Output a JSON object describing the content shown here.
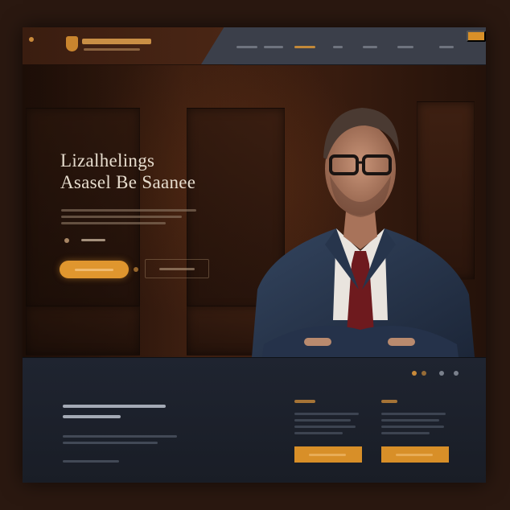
{
  "colors": {
    "accent": "#d89028",
    "wood_dark": "#2c150b",
    "wood_mid": "#4a2514",
    "footer_bg": "#1f2430",
    "headline_text": "#e6dccd",
    "suit": "#2a3850",
    "tie": "#6e1a1e"
  },
  "brand": {
    "logo_icon": "shield-icon",
    "name": "",
    "tagline": ""
  },
  "nav": {
    "items": [
      {
        "label": "",
        "active": false
      },
      {
        "label": "",
        "active": false
      },
      {
        "label": "",
        "active": true
      },
      {
        "label": "",
        "active": false
      },
      {
        "label": "",
        "active": false
      },
      {
        "label": "",
        "active": false
      }
    ],
    "cta_label": ""
  },
  "hero": {
    "headline_line1": "Lizalhelings",
    "headline_line2": "Asasel Be Saanee",
    "paragraph": "",
    "meta_icon": "info-icon",
    "meta_text": "",
    "primary_button": "",
    "arrow_icon": "arrow-right-icon",
    "secondary_button": "",
    "image": "professional-portrait-man-in-suit"
  },
  "footer": {
    "social_icons": [
      "social-icon-1",
      "social-icon-2",
      "social-icon-3"
    ],
    "title": "",
    "subtitle": "",
    "body": "",
    "card1": {
      "title": "",
      "button": ""
    },
    "card2": {
      "title": "",
      "button": ""
    }
  }
}
